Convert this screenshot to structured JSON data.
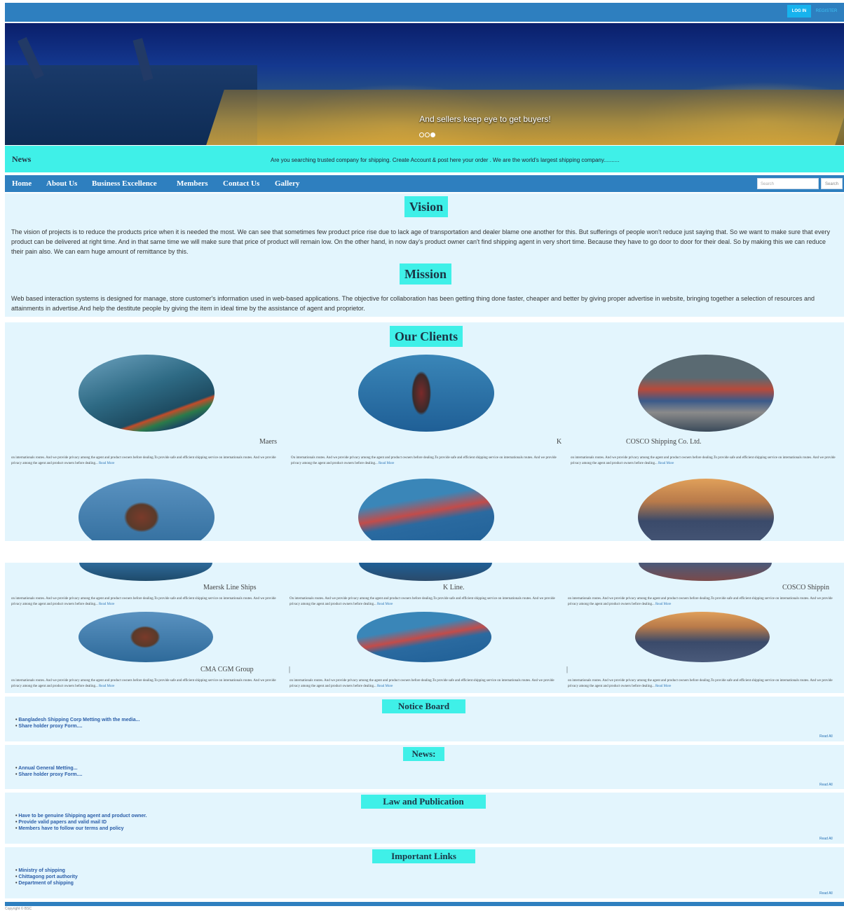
{
  "header": {
    "login_label": "LOG IN",
    "register_label": "REGISTER"
  },
  "hero": {
    "caption": "And sellers keep eye to get buyers!",
    "slides": 3,
    "active_slide": 3
  },
  "news_bar": {
    "label": "News",
    "ticker": "Are you searching trusted company for shipping.   Create Account & post here your order .   We are the world's largest shipping company.........."
  },
  "nav": {
    "items": [
      "Home",
      "About Us",
      "Business Excellence",
      "Members",
      "Contact Us",
      "Gallery"
    ],
    "search_placeholder": "Search",
    "search_button": "Search"
  },
  "vision": {
    "title": "Vision",
    "text": "The vision of projects is to reduce the products price when it is needed the most. We can see that sometimes few product price rise due to lack age of transportation and dealer blame one another for this. But sufferings of people won't reduce just saying that. So we want to make sure that every product can be delivered at right time. And in that same time we will make sure that price of product will remain low. On the other hand, in now day's product owner can't find shipping agent in very short time. Because they have to go door to door for their deal. So by making this we can reduce their pain also. We can earn huge amount of remittance by this."
  },
  "mission": {
    "title": "Mission",
    "text": "Web based interaction systems is designed for manage, store customer's information used in web-based applications. The objective for collaboration has been getting thing done faster, cheaper and better by giving proper advertise in website, bringing together a selection of resources and attainments in advertise.And help the destitute people by giving the item in ideal time by the assistance of agent and proprietor."
  },
  "clients": {
    "title": "Our Clients",
    "desc_upper": "on internationals routes. And we provide privacy among the agent and product owners before dealing.To provide safe and efficient shipping service on internationals routes. And we provide privacy among the agent and product owners before dealing...",
    "desc_upper_mid": "On internationals routes. And we provide privacy among the agent and product owners before dealing.To provide safe and efficient shipping service on internationals routes. And we provide privacy among the agent and product owners before dealing...",
    "read_more": "Read More",
    "row1_names": [
      "Maers",
      "K",
      "COSCO Shipping Co. Ltd."
    ],
    "row3_names": [
      "Maersk Line Ships",
      "K Line.",
      "COSCO Shippin"
    ],
    "row4_names": [
      "CMA CGM Group",
      "|",
      "|"
    ]
  },
  "notice_board": {
    "title": "Notice Board",
    "items": [
      "Bangladesh Shipping Corp Metting with the media...",
      "Share holder proxy Form...."
    ],
    "read_all": "Read All"
  },
  "news_section": {
    "title": "News:",
    "items": [
      "Annual General Metting...",
      "Share holder proxy Form...."
    ],
    "read_all": "Read All"
  },
  "law": {
    "title": "Law and Publication",
    "items": [
      "Have to be genuine Shipping agent and product owner.",
      "Provide valid papers and valid mail ID",
      "Members have to follow our terms and policy"
    ],
    "read_all": "Read All"
  },
  "links": {
    "title": "Important Links",
    "items": [
      "Ministry of shipping",
      "Chittagong port authority",
      "Department of shipping"
    ],
    "read_all": "Read All"
  },
  "footer": {
    "copyright": "Copyright © BSC"
  },
  "colors": {
    "primary_blue": "#2e7fbf",
    "accent_cyan": "#3ff0e8",
    "panel_bg": "#e3f5fd",
    "link_blue": "#2a5da8"
  }
}
